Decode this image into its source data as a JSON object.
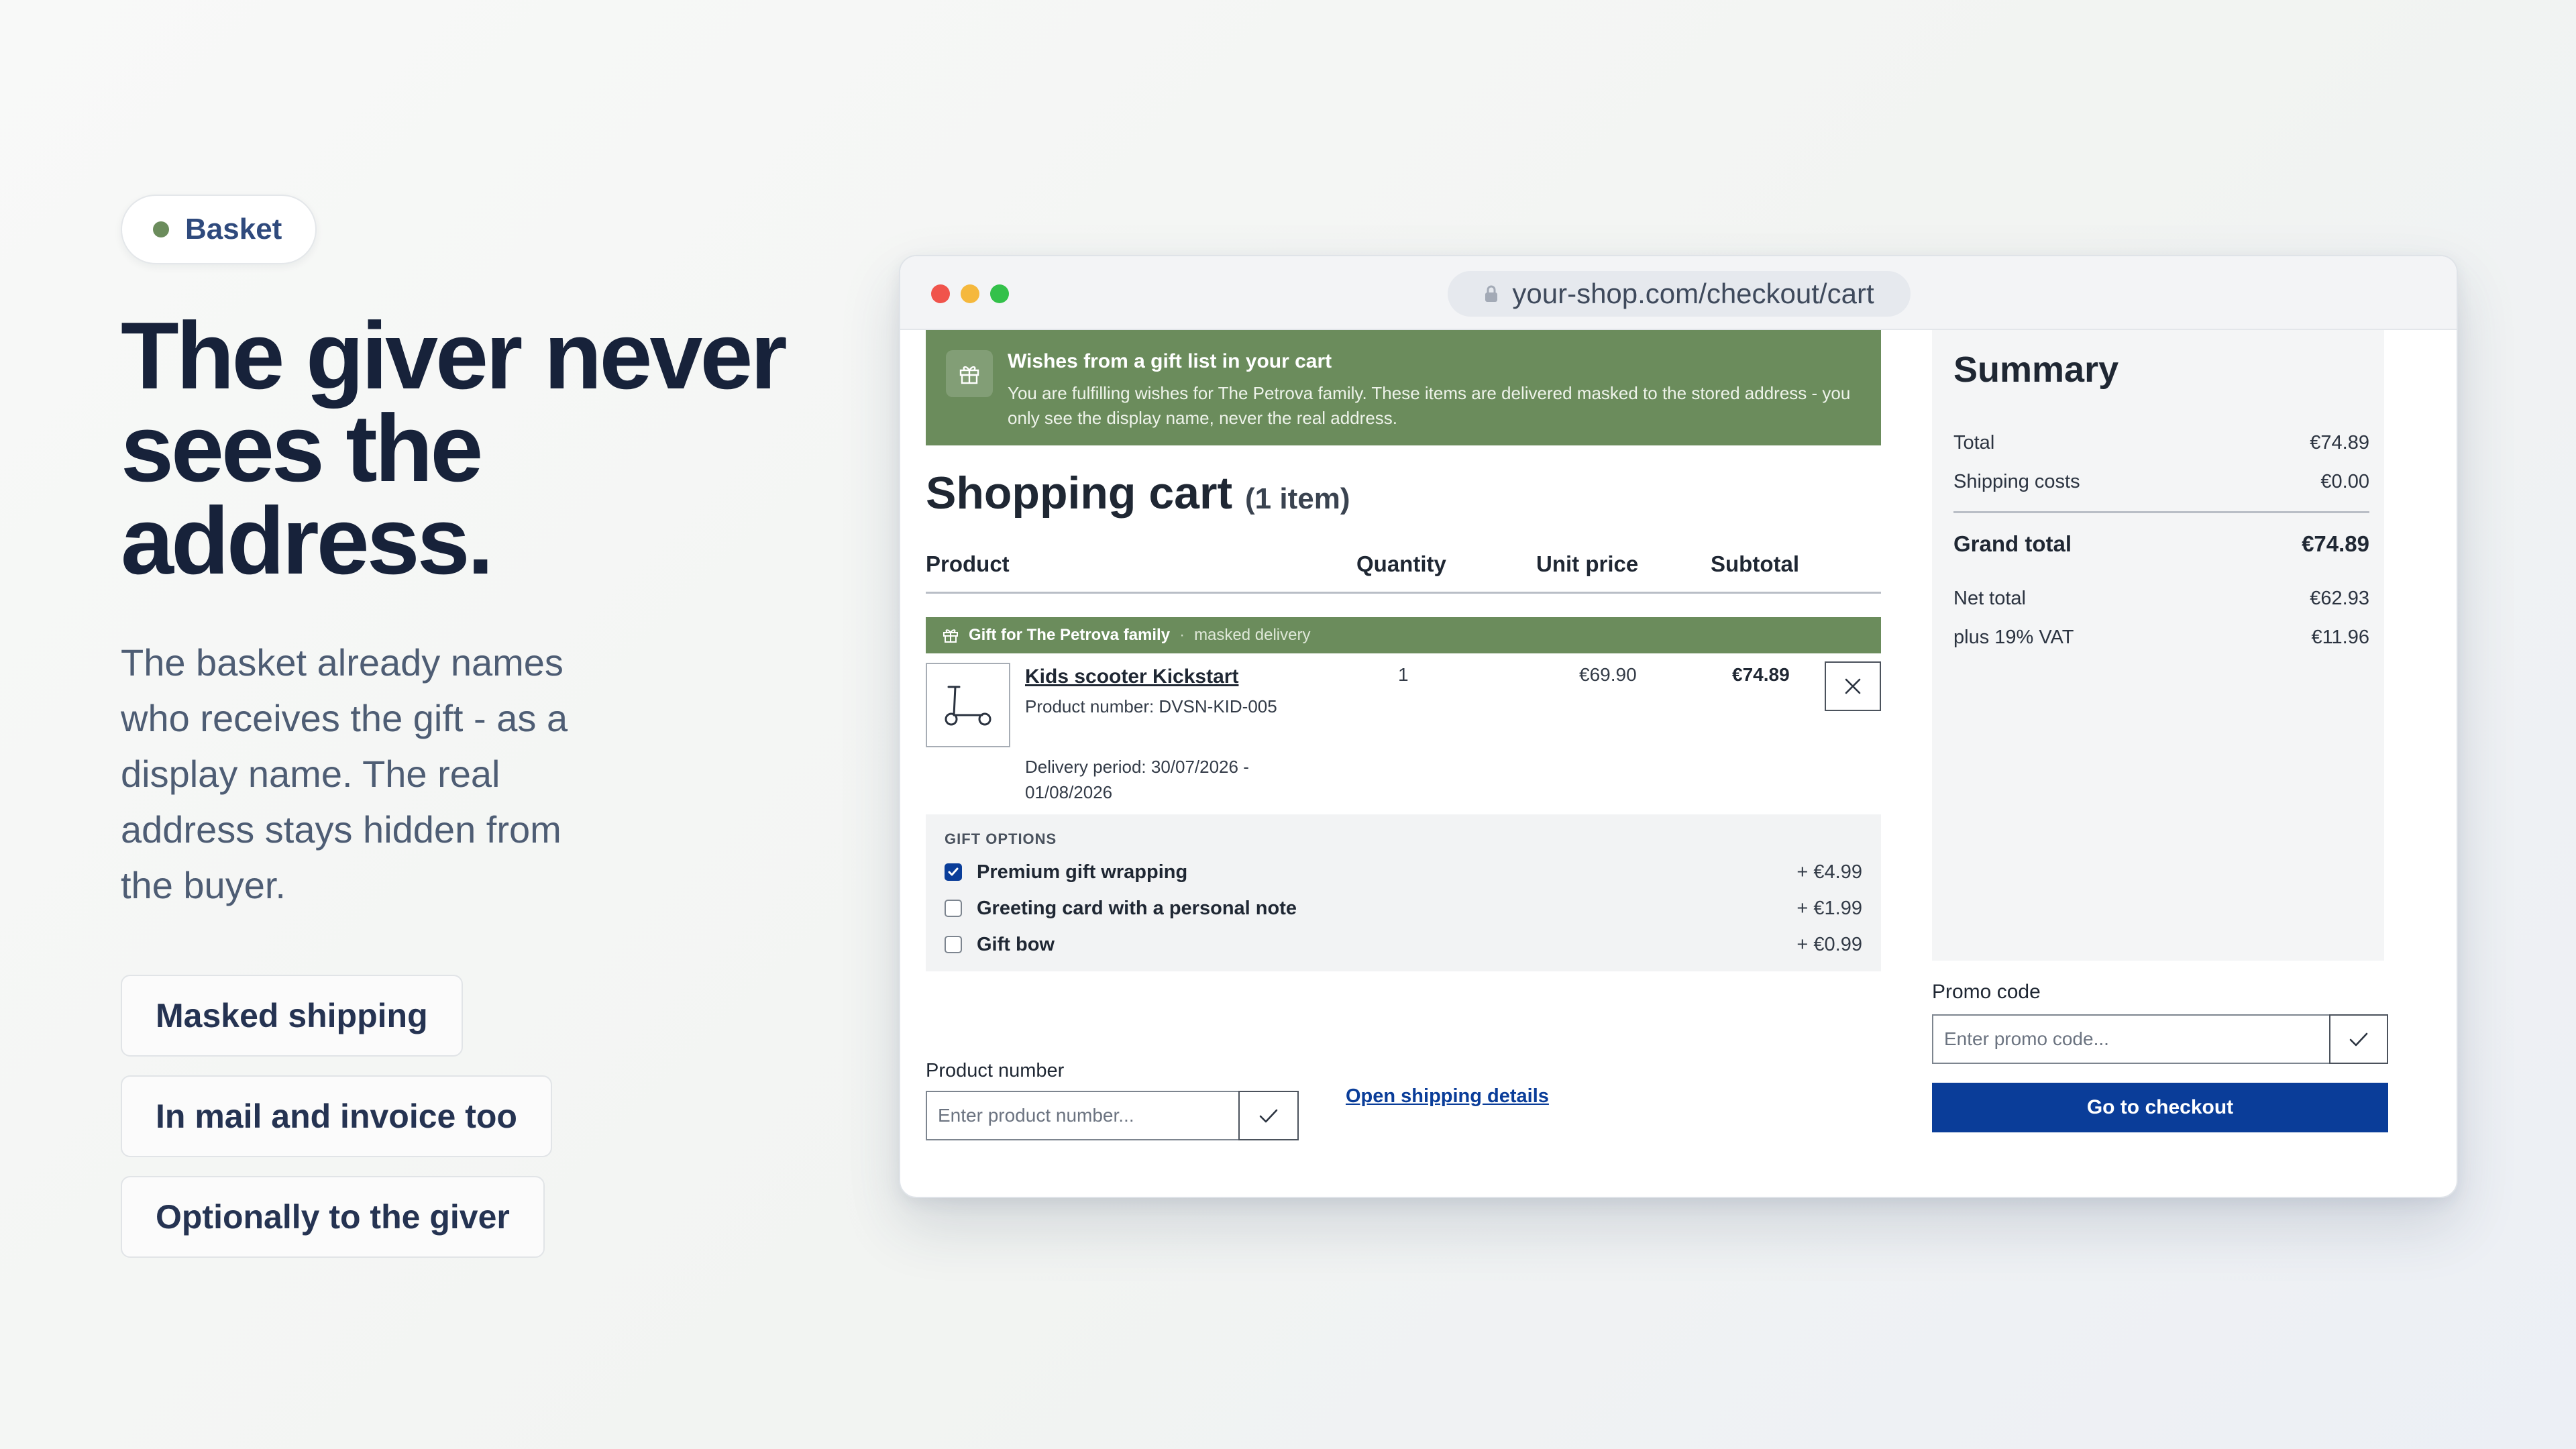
{
  "hero": {
    "badge": "Basket",
    "headline": "The giver never sees the address.",
    "description": "The basket already names who receives the gift - as a display name. The real address stays hidden from the buyer.",
    "features": [
      "Masked shipping",
      "In mail and invoice too",
      "Optionally to the giver"
    ]
  },
  "browser": {
    "url": "your-shop.com/checkout/cart"
  },
  "banner": {
    "title": "Wishes from a gift list in your cart",
    "text": "You are fulfilling wishes for The Petrova family. These items are delivered masked to the stored address - you only see the display name, never the real address."
  },
  "cart": {
    "title": "Shopping cart",
    "count": "(1 item)",
    "columns": {
      "product": "Product",
      "quantity": "Quantity",
      "unit_price": "Unit price",
      "subtotal": "Subtotal"
    },
    "gift_group": {
      "label": "Gift for The Petrova family",
      "separator": "·",
      "note": "masked delivery"
    },
    "item": {
      "name": "Kids scooter Kickstart",
      "product_number": "Product number: DVSN-KID-005",
      "delivery": "Delivery period: 30/07/2026 - 01/08/2026",
      "quantity": "1",
      "unit_price": "€69.90",
      "subtotal": "€74.89"
    },
    "gift_options": {
      "heading": "GIFT OPTIONS",
      "items": [
        {
          "label": "Premium gift wrapping",
          "price": "+ €4.99",
          "checked": true
        },
        {
          "label": "Greeting card with a personal note",
          "price": "+ €1.99",
          "checked": false
        },
        {
          "label": "Gift bow",
          "price": "+ €0.99",
          "checked": false
        }
      ]
    },
    "product_number_field": {
      "label": "Product number",
      "placeholder": "Enter product number..."
    },
    "shipping_link": "Open shipping details"
  },
  "summary": {
    "title": "Summary",
    "total_label": "Total",
    "total": "€74.89",
    "shipping_label": "Shipping costs",
    "shipping": "€0.00",
    "grand_label": "Grand total",
    "grand": "€74.89",
    "net_label": "Net total",
    "net": "€62.93",
    "vat_label": "plus 19% VAT",
    "vat": "€11.96",
    "promo_label": "Promo code",
    "promo_placeholder": "Enter promo code...",
    "checkout": "Go to checkout"
  },
  "colors": {
    "accent_green": "#6b8c5c",
    "primary_blue": "#0a3d99",
    "heading_navy": "#17223a"
  },
  "icons": {
    "banner": "gift-icon",
    "gift_group": "gift-icon",
    "thumbnail": "scooter-icon",
    "remove": "close-icon",
    "confirm": "checkmark-icon",
    "url": "lock-icon"
  }
}
